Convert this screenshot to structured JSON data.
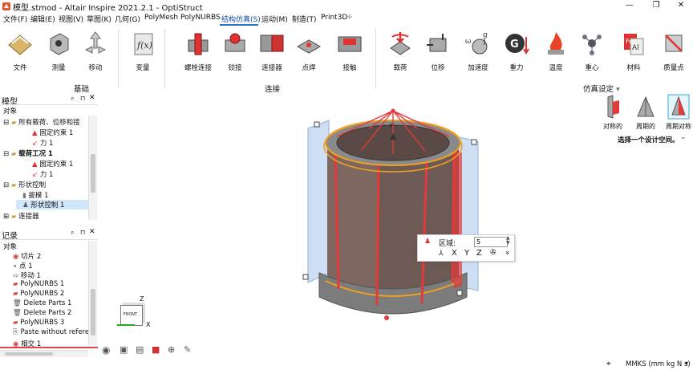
{
  "window": {
    "title": "模型.stmod - Altair Inspire 2021.2.1 - OptiStruct",
    "min": "—",
    "max": "❐",
    "close": "✕"
  },
  "menu": [
    "文件(F)",
    "编辑(E)",
    "视图(V)",
    "草图(K)",
    "几何(G)",
    "PolyMesh",
    "PolyNURBS",
    "结构仿真(S)",
    "运动(M)",
    "制造(T)",
    "Print3D"
  ],
  "menu_plus": "✚",
  "ribbon": {
    "basic": [
      "文件",
      "测量",
      "移动",
      "变量"
    ],
    "basic_group": "基础",
    "connect": [
      "螺栓连接",
      "铰接",
      "连接器",
      "点焊",
      "接触"
    ],
    "connect_group": "连接",
    "sim": [
      "载荷",
      "位移",
      "加速度",
      "重力",
      "温度",
      "重心",
      "材料",
      "质量点"
    ],
    "sim_group": "仿真设定",
    "sim_arrow": "▾",
    "design": [
      "对称的",
      "周期的",
      "周期对称"
    ],
    "design_hint": "选择一个设计空间。",
    "design_arrow": "⌄"
  },
  "model_panel": {
    "title": "模型",
    "column": "对象",
    "items": [
      {
        "text": "所有载荷、位移和接",
        "bold": false
      },
      {
        "text": "固定约束 1",
        "bold": false
      },
      {
        "text": "力 1",
        "bold": false
      },
      {
        "text": "载荷工况 1",
        "bold": true
      },
      {
        "text": "固定约束 1",
        "bold": false
      },
      {
        "text": "力 1",
        "bold": false
      },
      {
        "text": "形状控制",
        "bold": false
      },
      {
        "text": "拔模 1",
        "bold": false
      },
      {
        "text": "形状控制 1",
        "bold": false
      },
      {
        "text": "连接器",
        "bold": false
      }
    ]
  },
  "history_panel": {
    "title": "记录",
    "column": "对象",
    "items": [
      "切片 2",
      "点 1",
      "移动 1",
      "PolyNURBS 1",
      "PolyNURBS 2",
      "Delete Parts 1",
      "Delete Parts 2",
      "PolyNURBS 3",
      "Paste without reference",
      "相交 1"
    ]
  },
  "tool_popup": {
    "label": "区域:",
    "value": "5",
    "axes": [
      "X",
      "Y",
      "Z"
    ],
    "more": "»"
  },
  "viewcube": {
    "face": "FRONT",
    "z": "Z",
    "x": "X"
  },
  "status": {
    "units": "MMKS (mm kg N s)",
    "arrow": "▾"
  },
  "colors": {
    "accent": "#2a74c8",
    "model": "#6e5a55",
    "highlight": "#e23a3a",
    "plane": "#a9c6ea"
  }
}
